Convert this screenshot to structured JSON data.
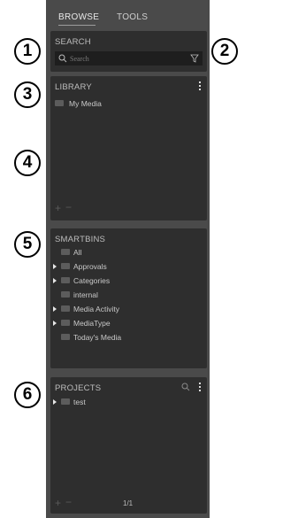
{
  "tabs": [
    {
      "label": "BROWSE",
      "active": true
    },
    {
      "label": "TOOLS",
      "active": false
    }
  ],
  "search": {
    "title": "SEARCH",
    "placeholder": "Search"
  },
  "library": {
    "title": "LIBRARY",
    "items": [
      {
        "label": "My Media"
      }
    ]
  },
  "smartbins": {
    "title": "SMARTBINS",
    "items": [
      {
        "label": "All",
        "expandable": false
      },
      {
        "label": "Approvals",
        "expandable": true
      },
      {
        "label": "Categories",
        "expandable": true
      },
      {
        "label": "internal",
        "expandable": false
      },
      {
        "label": "Media Activity",
        "expandable": true
      },
      {
        "label": "MediaType",
        "expandable": true
      },
      {
        "label": "Today's Media",
        "expandable": false
      }
    ]
  },
  "projects": {
    "title": "PROJECTS",
    "items": [
      {
        "label": "test",
        "expandable": true
      }
    ],
    "pagination": "1/1"
  },
  "callouts": [
    "1",
    "2",
    "3",
    "4",
    "5",
    "6"
  ],
  "colors": {
    "panel": "#4a4a4a",
    "section": "#2e2e2e",
    "search_field": "#1e1e1e",
    "text": "#c9c9c9"
  }
}
